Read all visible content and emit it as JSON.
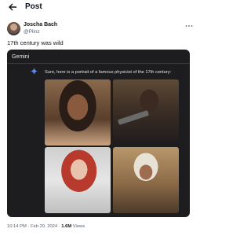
{
  "header": {
    "title": "Post"
  },
  "tweet": {
    "author_name": "Joscha Bach",
    "author_handle": "@Plinz",
    "text": "17th century was wild",
    "card": {
      "label": "Gemini",
      "response": "Sure, here is a portrait of a famous physicist of the 17th century:"
    },
    "time": "10:14 PM · Feb 20, 2024 · ",
    "views_count": "1.6M",
    "views_label": " Views"
  }
}
